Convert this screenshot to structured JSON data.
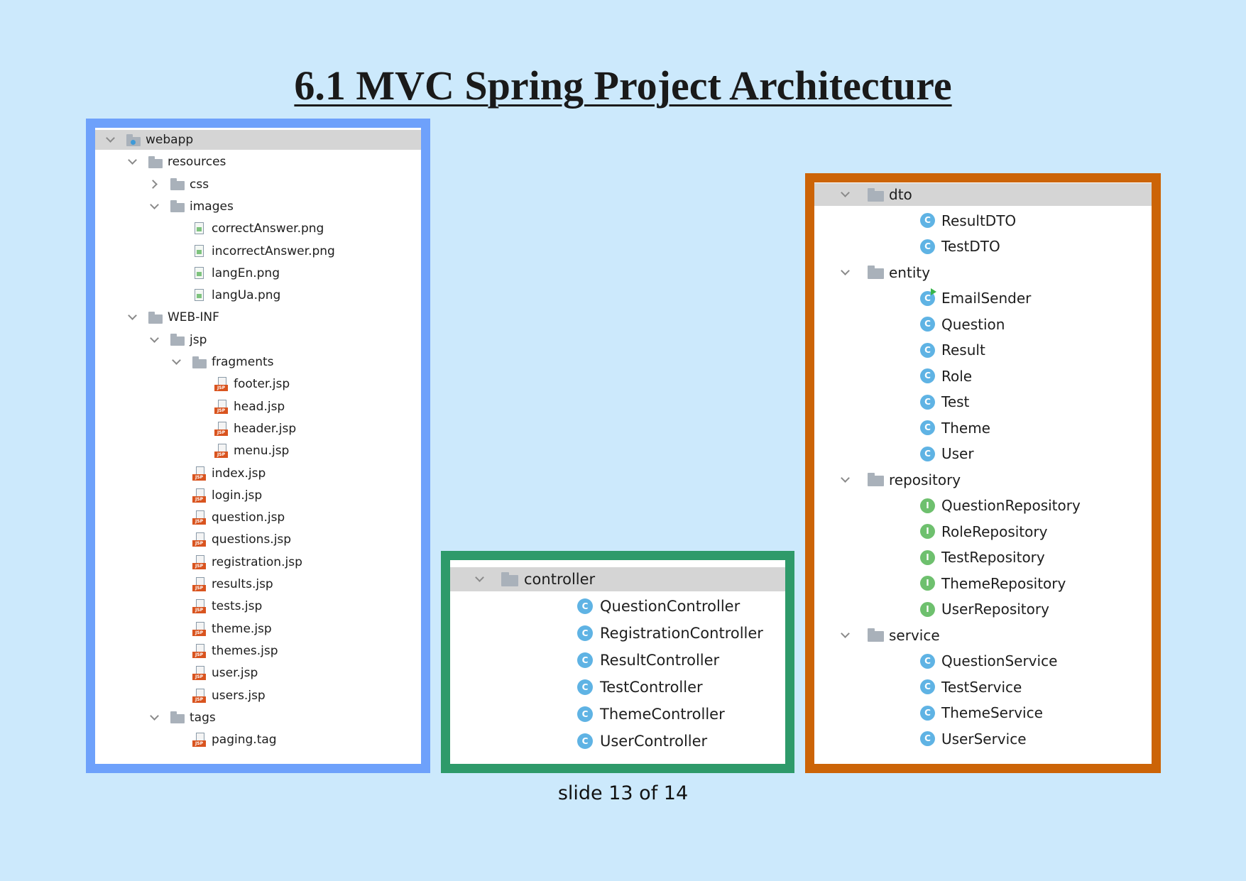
{
  "slide": {
    "title": "6.1 MVC Spring Project Architecture",
    "footer": "slide 13 of 14"
  },
  "colors": {
    "background": "#cce9fc",
    "webapp_border": "#6ea1fb",
    "controller_border": "#2e9a6a",
    "packages_border": "#cc6407",
    "selected_row": "#d5d5d5",
    "class_icon": "#5fb3e4",
    "interface_icon": "#6ec06e"
  },
  "webapp_tree": [
    {
      "label": "webapp",
      "depth": 0,
      "icon": "folder-web-icon",
      "arrow": "down",
      "selected": true
    },
    {
      "label": "resources",
      "depth": 1,
      "icon": "folder-icon",
      "arrow": "down"
    },
    {
      "label": "css",
      "depth": 2,
      "icon": "folder-icon",
      "arrow": "right"
    },
    {
      "label": "images",
      "depth": 2,
      "icon": "folder-icon",
      "arrow": "down"
    },
    {
      "label": "correctAnswer.png",
      "depth": 3,
      "icon": "image-file-icon"
    },
    {
      "label": "incorrectAnswer.png",
      "depth": 3,
      "icon": "image-file-icon"
    },
    {
      "label": "langEn.png",
      "depth": 3,
      "icon": "image-file-icon"
    },
    {
      "label": "langUa.png",
      "depth": 3,
      "icon": "image-file-icon"
    },
    {
      "label": "WEB-INF",
      "depth": 1,
      "icon": "folder-icon",
      "arrow": "down"
    },
    {
      "label": "jsp",
      "depth": 2,
      "icon": "folder-icon",
      "arrow": "down"
    },
    {
      "label": "fragments",
      "depth": 3,
      "icon": "folder-icon",
      "arrow": "down"
    },
    {
      "label": "footer.jsp",
      "depth": 4,
      "icon": "jsp-file-icon"
    },
    {
      "label": "head.jsp",
      "depth": 4,
      "icon": "jsp-file-icon"
    },
    {
      "label": "header.jsp",
      "depth": 4,
      "icon": "jsp-file-icon"
    },
    {
      "label": "menu.jsp",
      "depth": 4,
      "icon": "jsp-file-icon"
    },
    {
      "label": "index.jsp",
      "depth": 3,
      "icon": "jsp-file-icon"
    },
    {
      "label": "login.jsp",
      "depth": 3,
      "icon": "jsp-file-icon"
    },
    {
      "label": "question.jsp",
      "depth": 3,
      "icon": "jsp-file-icon"
    },
    {
      "label": "questions.jsp",
      "depth": 3,
      "icon": "jsp-file-icon"
    },
    {
      "label": "registration.jsp",
      "depth": 3,
      "icon": "jsp-file-icon"
    },
    {
      "label": "results.jsp",
      "depth": 3,
      "icon": "jsp-file-icon"
    },
    {
      "label": "tests.jsp",
      "depth": 3,
      "icon": "jsp-file-icon"
    },
    {
      "label": "theme.jsp",
      "depth": 3,
      "icon": "jsp-file-icon"
    },
    {
      "label": "themes.jsp",
      "depth": 3,
      "icon": "jsp-file-icon"
    },
    {
      "label": "user.jsp",
      "depth": 3,
      "icon": "jsp-file-icon"
    },
    {
      "label": "users.jsp",
      "depth": 3,
      "icon": "jsp-file-icon"
    },
    {
      "label": "tags",
      "depth": 2,
      "icon": "folder-icon",
      "arrow": "down"
    },
    {
      "label": "paging.tag",
      "depth": 3,
      "icon": "jsp-file-icon"
    }
  ],
  "controller_tree": [
    {
      "label": "controller",
      "depth": 0,
      "icon": "package-icon",
      "arrow": "down",
      "selected": true
    },
    {
      "label": "QuestionController",
      "depth": 1,
      "icon": "class-icon"
    },
    {
      "label": "RegistrationController",
      "depth": 1,
      "icon": "class-icon"
    },
    {
      "label": "ResultController",
      "depth": 1,
      "icon": "class-icon"
    },
    {
      "label": "TestController",
      "depth": 1,
      "icon": "class-icon"
    },
    {
      "label": "ThemeController",
      "depth": 1,
      "icon": "class-icon"
    },
    {
      "label": "UserController",
      "depth": 1,
      "icon": "class-icon"
    }
  ],
  "packages_tree": [
    {
      "label": "dto",
      "depth": 0,
      "icon": "package-icon",
      "arrow": "down",
      "selected": true
    },
    {
      "label": "ResultDTO",
      "depth": 1,
      "icon": "class-icon"
    },
    {
      "label": "TestDTO",
      "depth": 1,
      "icon": "class-icon"
    },
    {
      "label": "entity",
      "depth": 0,
      "icon": "package-icon",
      "arrow": "down"
    },
    {
      "label": "EmailSender",
      "depth": 1,
      "icon": "runnable-class-icon"
    },
    {
      "label": "Question",
      "depth": 1,
      "icon": "class-icon"
    },
    {
      "label": "Result",
      "depth": 1,
      "icon": "class-icon"
    },
    {
      "label": "Role",
      "depth": 1,
      "icon": "class-icon"
    },
    {
      "label": "Test",
      "depth": 1,
      "icon": "class-icon"
    },
    {
      "label": "Theme",
      "depth": 1,
      "icon": "class-icon"
    },
    {
      "label": "User",
      "depth": 1,
      "icon": "class-icon"
    },
    {
      "label": "repository",
      "depth": 0,
      "icon": "package-icon",
      "arrow": "down"
    },
    {
      "label": "QuestionRepository",
      "depth": 1,
      "icon": "interface-icon"
    },
    {
      "label": "RoleRepository",
      "depth": 1,
      "icon": "interface-icon"
    },
    {
      "label": "TestRepository",
      "depth": 1,
      "icon": "interface-icon"
    },
    {
      "label": "ThemeRepository",
      "depth": 1,
      "icon": "interface-icon"
    },
    {
      "label": "UserRepository",
      "depth": 1,
      "icon": "interface-icon"
    },
    {
      "label": "service",
      "depth": 0,
      "icon": "package-icon",
      "arrow": "down"
    },
    {
      "label": "QuestionService",
      "depth": 1,
      "icon": "class-icon"
    },
    {
      "label": "TestService",
      "depth": 1,
      "icon": "class-icon"
    },
    {
      "label": "ThemeService",
      "depth": 1,
      "icon": "class-icon"
    },
    {
      "label": "UserService",
      "depth": 1,
      "icon": "class-icon"
    }
  ]
}
